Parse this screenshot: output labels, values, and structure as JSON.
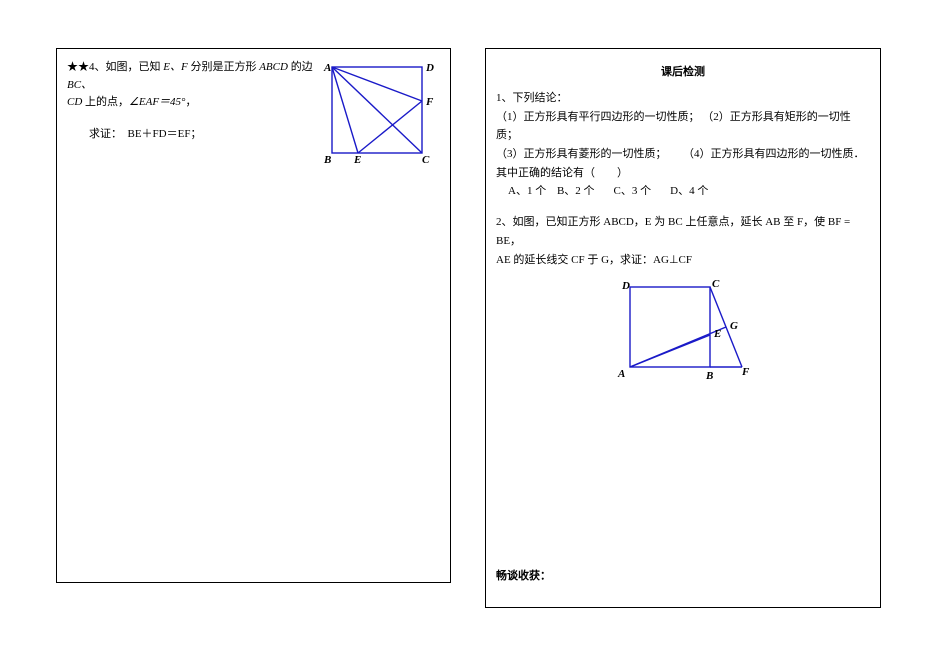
{
  "left": {
    "p4": {
      "stars": "★★4、",
      "stem_a": "如图，已知 ",
      "ef": "E、F",
      "stem_b": " 分别是正方形 ",
      "abcd": "ABCD",
      "stem_c": " 的边 ",
      "bc": "BC、",
      "cd": "CD",
      "stem_d": " 上的点，",
      "angle": "∠EAF＝45°",
      "comma": "，",
      "prove_label": "求证：",
      "prove_eq": "BE＋FD＝EF；"
    },
    "fig1_labels": {
      "A": "A",
      "B": "B",
      "C": "C",
      "D": "D",
      "E": "E",
      "F": "F"
    }
  },
  "right": {
    "title": "课后检测",
    "q1": {
      "lead": "1、下列结论：",
      "c1": "（1）正方形具有平行四边形的一切性质；",
      "c2": "（2）正方形具有矩形的一切性质；",
      "c3": "（3）正方形具有菱形的一切性质；",
      "c4": "（4）正方形具有四边形的一切性质．",
      "tail": "其中正确的结论有（　　）",
      "optA": "A、1 个",
      "optB": "B、2 个",
      "optC": "C、3 个",
      "optD": "D、4 个"
    },
    "q2": {
      "line1": "2、如图，已知正方形 ABCD，E 为 BC 上任意点，延长 AB 至 F，使 BF = BE，",
      "line2": "AE 的延长线交 CF 于 G，求证：AG⊥CF"
    },
    "fig2_labels": {
      "A": "A",
      "B": "B",
      "C": "C",
      "D": "D",
      "E": "E",
      "F": "F",
      "G": "G"
    },
    "harvest": "畅谈收获："
  }
}
